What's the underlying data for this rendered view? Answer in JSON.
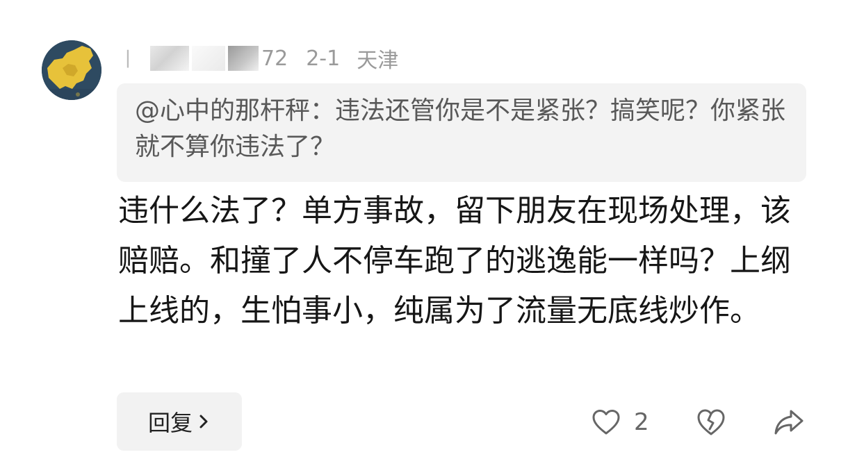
{
  "comment": {
    "username_visible": "72",
    "date": "2-1",
    "location": "天津",
    "quote": "@心中的那杆秤：违法还管你是不是紧张？搞笑呢？你紧张就不算你违法了？",
    "body": "违什么法了？单方事故，留下朋友在现场处理，该赔赔。和撞了人不停车跑了的逃逸能一样吗？上纲上线的，生怕事小，纯属为了流量无底线炒作。"
  },
  "actions": {
    "reply_label": "回复",
    "like_count": "2"
  },
  "icons": {
    "avatar": "china-map-avatar",
    "reply_chevron": "chevron-right-icon",
    "like": "heart-icon",
    "dislike": "broken-heart-icon",
    "share": "share-arrow-icon"
  }
}
